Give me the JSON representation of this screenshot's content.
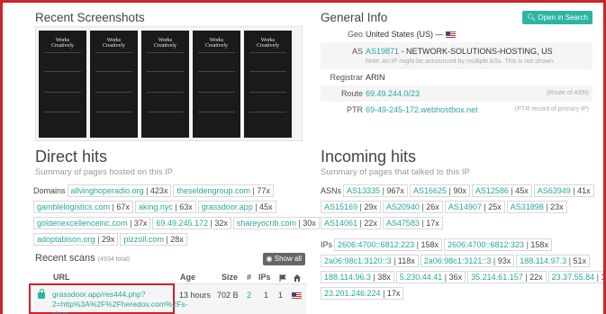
{
  "screenshots": {
    "title": "Recent Screenshots",
    "logo_line1": "Works",
    "logo_line2": "Creatively"
  },
  "general_info": {
    "title": "General Info",
    "open_button": "Open in Search",
    "geo_label": "Geo",
    "geo_value": "United States (US) —",
    "as_label": "AS",
    "as_link": "AS19871",
    "as_name": "- NETWORK-SOLUTIONS-HOSTING, US",
    "as_note": "Note: An IP might be announced by multiple ASs. This is not shown.",
    "registrar_label": "Registrar",
    "registrar_value": "ARIN",
    "route_label": "Route",
    "route_value": "69.49.244.0/23",
    "route_note": "(Route of ASN)",
    "ptr_label": "PTR",
    "ptr_value": "69-49-245-172.webhostbox.net",
    "ptr_note": "(PTR record of primary IP)"
  },
  "direct_hits": {
    "title": "Direct hits",
    "subtitle": "Summary of pages hosted on this IP",
    "domains_label": "Domains",
    "domains": [
      {
        "name": "allvinghoperadio.org",
        "count": "423x"
      },
      {
        "name": "theseldengroup.com",
        "count": "77x"
      },
      {
        "name": "gamblelogistics.com",
        "count": "67x"
      },
      {
        "name": "aking.nyc",
        "count": "63x"
      },
      {
        "name": "grassdoor.app",
        "count": "45x"
      },
      {
        "name": "goldenexcellenceinc.com",
        "count": "37x"
      },
      {
        "name": "69.49.245.172",
        "count": "32x"
      },
      {
        "name": "shareyocrib.com",
        "count": "30x"
      },
      {
        "name": "adoptabison.org",
        "count": "29x"
      },
      {
        "name": "pizzoll.com",
        "count": "28x"
      }
    ]
  },
  "recent_scans": {
    "title": "Recent scans",
    "total": "(4934 total)",
    "show_all": "Show all",
    "columns": {
      "url": "URL",
      "age": "Age",
      "size": "Size",
      "requests": "#",
      "ips": "IPs"
    },
    "rows": [
      {
        "url": "grassdoor.app/res444.php?2=http%3A%2F%2Fheredox.com%2Fs-skun",
        "age": "13 hours",
        "size": "702 B",
        "requests": "2",
        "ips": "1",
        "countries": "1"
      }
    ]
  },
  "incoming_hits": {
    "title": "Incoming hits",
    "subtitle": "Summary of pages that talked to this IP",
    "asns_label": "ASNs",
    "asns": [
      {
        "name": "AS13335",
        "count": "967x"
      },
      {
        "name": "AS16625",
        "count": "90x"
      },
      {
        "name": "AS12586",
        "count": "45x"
      },
      {
        "name": "AS63949",
        "count": "41x"
      },
      {
        "name": "AS15169",
        "count": "29x"
      },
      {
        "name": "AS20940",
        "count": "26x"
      },
      {
        "name": "AS14907",
        "count": "25x"
      },
      {
        "name": "AS31898",
        "count": "23x"
      },
      {
        "name": "AS14061",
        "count": "22x"
      },
      {
        "name": "AS47583",
        "count": "17x"
      }
    ],
    "ips_label": "IPs",
    "ips": [
      {
        "name": "2606:4700::6812:223",
        "count": "158x"
      },
      {
        "name": "2606:4700::6812:323",
        "count": "158x"
      },
      {
        "name": "2a06:98c1:3120::3",
        "count": "118x"
      },
      {
        "name": "2a06:98c1:3121::3",
        "count": "93x"
      },
      {
        "name": "188.114.97.3",
        "count": "51x"
      },
      {
        "name": "188.114.96.3",
        "count": "38x"
      },
      {
        "name": "5.230.44.41",
        "count": "36x"
      },
      {
        "name": "35.214.61.157",
        "count": "22x"
      },
      {
        "name": "23.37.55.84",
        "count": "18x"
      },
      {
        "name": "23.201.246.224",
        "count": "17x"
      }
    ]
  }
}
